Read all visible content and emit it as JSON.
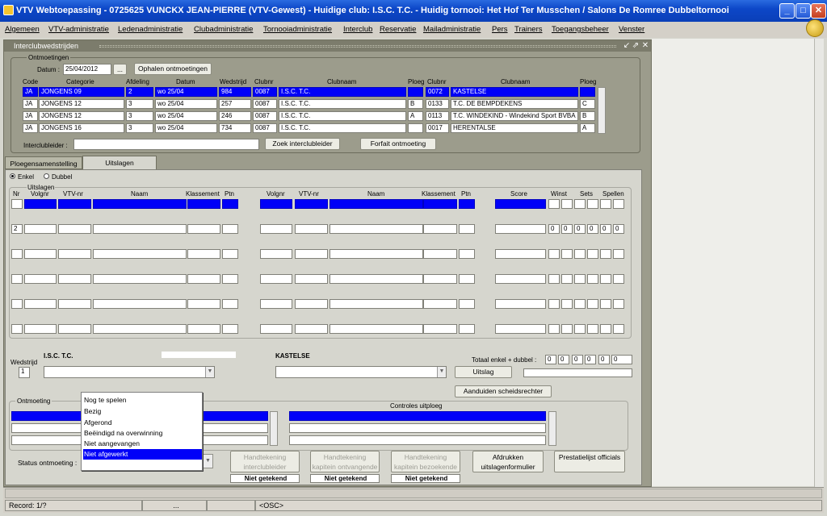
{
  "window": {
    "title": "VTV Webtoepassing - 0725625 VUNCKX  JEAN-PIERRE (VTV-Gewest) - Huidige club: I.S.C. T.C. - Huidig tornooi: Het Hof Ter Musschen / Salons De Romree Dubbeltornooi",
    "min": "_",
    "max": "□",
    "close": "✕"
  },
  "menu": [
    "Algemeen",
    "VTV-administratie",
    "Ledenadministratie",
    "Clubadministratie",
    "Tornooiadministratie",
    "Interclub",
    "Reservatie",
    "Mailadministratie",
    "Pers",
    "Trainers",
    "Toegangsbeheer",
    "Venster"
  ],
  "form": {
    "title": "Interclubwedstrijden",
    "ontmoetingen": {
      "legend": "Ontmoetingen",
      "datum_label": "Datum :",
      "datum": "25/04/2012",
      "dots": "...",
      "fetch": "Ophalen ontmoetingen"
    },
    "cols": [
      "Code",
      "Categorie",
      "Afdeling",
      "Datum",
      "Wedstrijd",
      "Clubnr",
      "Clubnaam",
      "Ploeg",
      "Clubnr",
      "Clubnaam",
      "Ploeg"
    ],
    "rows": [
      [
        "JA",
        "JONGENS 09",
        "2",
        "wo 25/04",
        "984",
        "0087",
        "I.S.C. T.C.",
        "",
        "0072",
        "KASTELSE",
        ""
      ],
      [
        "JA",
        "JONGENS 12",
        "3",
        "wo 25/04",
        "257",
        "0087",
        "I.S.C. T.C.",
        "B",
        "0133",
        "T.C. DE BEMPDEKENS",
        "C"
      ],
      [
        "JA",
        "JONGENS 12",
        "3",
        "wo 25/04",
        "246",
        "0087",
        "I.S.C. T.C.",
        "A",
        "0113",
        "T.C. WINDEKIND - Windekind Sport BVBA",
        "B"
      ],
      [
        "JA",
        "JONGENS 16",
        "3",
        "wo 25/04",
        "734",
        "0087",
        "I.S.C. T.C.",
        "",
        "0017",
        "HERENTALSE",
        "A"
      ]
    ],
    "interclubleider_label": "Interclubleider :",
    "zoek": "Zoek interclubleider",
    "forfait": "Forfait ontmoeting",
    "tabs": [
      "Ploegensamenstelling",
      "Uitslagen"
    ],
    "radio": {
      "enkel": "Enkel",
      "dubbel": "Dubbel"
    },
    "uitslagen_legend": "Uitslagen",
    "res_cols_left": [
      "Nr",
      "Volgnr",
      "VTV-nr",
      "Naam",
      "Klassement",
      "Ptn"
    ],
    "res_cols_right": [
      "Volgnr",
      "VTV-nr",
      "Naam",
      "Klassement",
      "Ptn"
    ],
    "res_cols_score": [
      "Score",
      "Winst",
      "Sets",
      "Spellen"
    ],
    "row_numbers": [
      "1",
      "2"
    ],
    "zero": "0",
    "wedstrijd_label": "Wedstrijd",
    "wedstrijd_nr": "1",
    "club_left": "I.S.C. T.C.",
    "club_right": "KASTELSE",
    "totaal_label": "Totaal enkel + dubbel :",
    "uitslag": "Uitslag",
    "scheids": "Aanduiden scheidsrechter",
    "ontmoeting_legend": "Ontmoeting",
    "controles": "Controles uitploeg",
    "status_label": "Status ontmoeting :",
    "status_options": [
      "Nog te spelen",
      "Bezig",
      "Afgerond",
      "Beëindigd na overwinning",
      "Niet aangevangen",
      "Niet afgewerkt"
    ],
    "status_selected": "Niet afgewerkt",
    "sign1": "Handtekening interclubleider",
    "sign2": "Handtekening kapitein ontvangende ploeg",
    "sign3": "Handtekening kapitein bezoekende ploeg",
    "niet": "Niet getekend",
    "afdrukken": "Afdrukken uitslagenformulier",
    "prestatie": "Prestatielijst officials"
  },
  "status": {
    "record": "Record: 1/?",
    "seg2": "...",
    "osc": "<OSC>"
  }
}
